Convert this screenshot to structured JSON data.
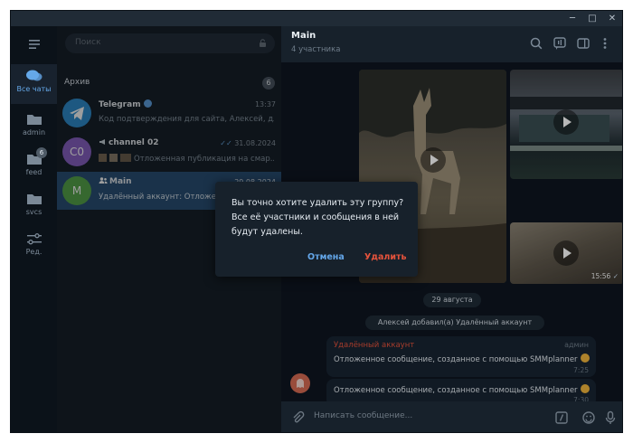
{
  "titlebar": {
    "minimize": "─",
    "maximize": "□",
    "close": "✕"
  },
  "rail": {
    "items": [
      {
        "label": "Все чаты",
        "icon": "chat-bubbles-icon"
      },
      {
        "label": "admin",
        "icon": "folder-icon"
      },
      {
        "label": "feed",
        "icon": "folder-icon",
        "badge": "6"
      },
      {
        "label": "svcs",
        "icon": "folder-icon"
      },
      {
        "label": "Ред.",
        "icon": "sliders-icon"
      }
    ]
  },
  "search": {
    "placeholder": "Поиск"
  },
  "archive": {
    "label": "Архив",
    "count": "6"
  },
  "chats": [
    {
      "name": "Telegram",
      "time": "13:37",
      "preview": "Код подтверждения для сайта, Алексей, для...",
      "avatar_color": "#2f8fd0"
    },
    {
      "name": "channel 02",
      "time": "31.08.2024",
      "preview": "Отложенная публикация на смар...",
      "avatar_text": "C0",
      "avatar_color": "#8a63c7"
    },
    {
      "name": "Main",
      "time": "29.08.2024",
      "preview": "Удалённый аккаунт: Отложенное...",
      "avatar_text": "M",
      "avatar_color": "#58a84d"
    }
  ],
  "main": {
    "title": "Main",
    "subtitle": "4 участника",
    "video_duration": "15:56",
    "date_pill": "29 августа",
    "service_message": "Алексей добавил(а) Удалённый аккаунт",
    "messages": [
      {
        "sender": "Удалённый аккаунт",
        "role": "админ",
        "text": "Отложенное сообщение, созданное с помощью SMMplanner",
        "time": "7:25"
      },
      {
        "text": "Отложенное сообщение, созданное с помощью SMMplanner",
        "time": "7:30"
      }
    ],
    "composer_placeholder": "Написать сообщение..."
  },
  "dialog": {
    "text": "Вы точно хотите удалить эту группу? Все её участники и сообщения в ней будут удалены.",
    "cancel": "Отмена",
    "delete": "Удалить",
    "cancel_color": "#64a7ea",
    "delete_color": "#e5533c"
  }
}
